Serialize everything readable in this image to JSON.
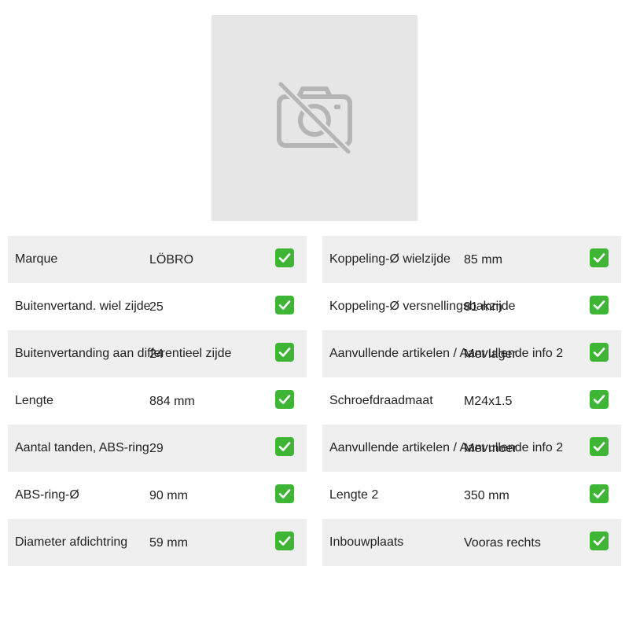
{
  "image": {
    "icon": "no-photo-icon",
    "background": "#e6e6e6",
    "icon_color": "#b5b5b5"
  },
  "check_color": "#3fb536",
  "row_colors": {
    "shaded": "#efefef",
    "plain": "#ffffff"
  },
  "left_specs": [
    {
      "label": "Marque",
      "value": "LÖBRO"
    },
    {
      "label": "Buitenvertand. wiel zijde",
      "value": "25"
    },
    {
      "label": "Buitenvertanding aan differentieel zijde",
      "value": "24"
    },
    {
      "label": "Lengte",
      "value": "884 mm"
    },
    {
      "label": "Aantal tanden, ABS-ring",
      "value": "29"
    },
    {
      "label": "ABS-ring-Ø",
      "value": "90 mm"
    },
    {
      "label": "Diameter afdichtring",
      "value": "59 mm"
    }
  ],
  "right_specs": [
    {
      "label": "Koppeling-Ø wielzijde",
      "value": "85 mm"
    },
    {
      "label": "Koppeling-Ø versnellingsbakzijde",
      "value": "81 mm"
    },
    {
      "label": "Aanvullende artikelen / Aanvullende info 2",
      "value": "Met lager"
    },
    {
      "label": "Schroefdraadmaat",
      "value": "M24x1.5"
    },
    {
      "label": "Aanvullende artikelen / Aanvullende info 2",
      "value": "Met moer"
    },
    {
      "label": "Lengte 2",
      "value": "350 mm"
    },
    {
      "label": "Inbouwplaats",
      "value": "Vooras rechts"
    }
  ]
}
